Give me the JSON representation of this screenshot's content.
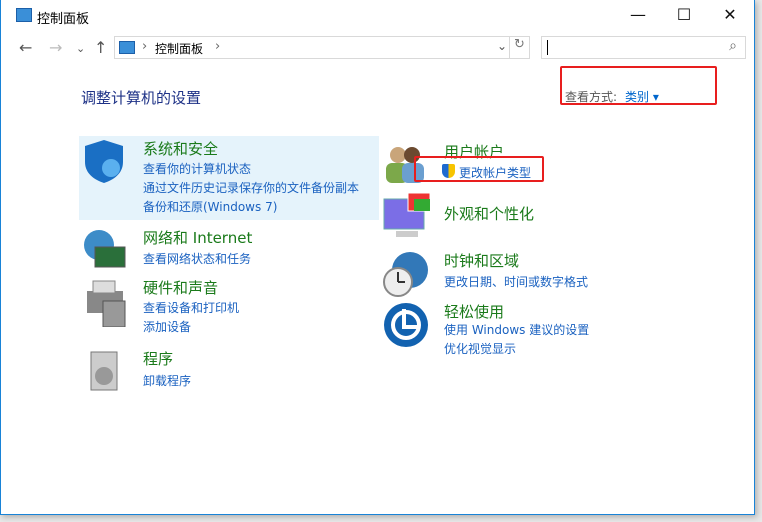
{
  "window": {
    "title": "控制面板",
    "minimize": "—",
    "maximize": "☐",
    "close": "✕"
  },
  "nav": {
    "back": "←",
    "forward": "→",
    "recent": "⌄",
    "up": "↑",
    "refresh": "↻",
    "dropdown": "⌄"
  },
  "address": {
    "crumb": "控制面板",
    "sep": "›"
  },
  "search": {
    "placeholder": "",
    "icon": "⌕"
  },
  "heading": "调整计算机的设置",
  "view_by": {
    "label": "查看方式:",
    "value": "类别",
    "arrow": "▾"
  },
  "categories": [
    {
      "title": "系统和安全",
      "links": [
        "查看你的计算机状态",
        "通过文件历史记录保存你的文件备份副本",
        "备份和还原(Windows 7)"
      ]
    },
    {
      "title": "网络和 Internet",
      "links": [
        "查看网络状态和任务"
      ]
    },
    {
      "title": "硬件和声音",
      "links": [
        "查看设备和打印机",
        "添加设备"
      ]
    },
    {
      "title": "程序",
      "links": [
        "卸载程序"
      ]
    },
    {
      "title": "用户帐户",
      "links": [
        "更改帐户类型"
      ]
    },
    {
      "title": "外观和个性化",
      "links": []
    },
    {
      "title": "时钟和区域",
      "links": [
        "更改日期、时间或数字格式"
      ]
    },
    {
      "title": "轻松使用",
      "links": [
        "使用 Windows 建议的设置",
        "优化视觉显示"
      ]
    }
  ]
}
